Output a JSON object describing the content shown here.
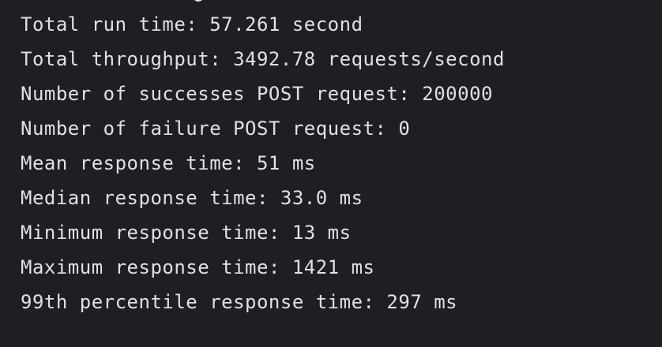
{
  "console": {
    "lines": [
      "Total run time: 57.261 second",
      "Total throughput: 3492.78 requests/second",
      "Number of successes POST request: 200000",
      "Number of failure POST request: 0",
      "Mean response time: 51 ms",
      "Median response time: 33.0 ms",
      "Minimum response time: 13 ms",
      "Maximum response time: 1421 ms",
      "99th percentile response time: 297 ms"
    ]
  },
  "colors": {
    "background": "#1e1f22",
    "text": "#dfe1e5"
  }
}
